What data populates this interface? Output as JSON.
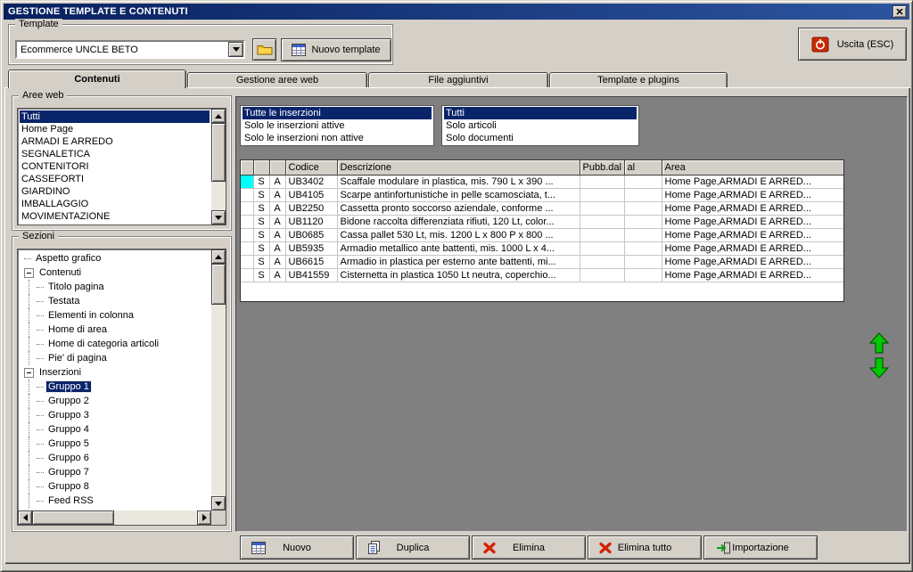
{
  "window": {
    "title": "GESTIONE TEMPLATE E CONTENUTI"
  },
  "toolbar": {
    "template_group_label": "Template",
    "template_combo_value": "Ecommerce UNCLE BETO",
    "new_template_label": "Nuovo template",
    "exit_label": "Uscita (ESC)"
  },
  "tabs": [
    {
      "label": "Contenuti",
      "active": true
    },
    {
      "label": "Gestione aree web",
      "active": false
    },
    {
      "label": "File aggiuntivi",
      "active": false
    },
    {
      "label": "Template e plugins",
      "active": false
    }
  ],
  "aree_web": {
    "group_label": "Aree web",
    "items": [
      {
        "label": "Tutti",
        "selected": true
      },
      {
        "label": "Home Page"
      },
      {
        "label": "ARMADI E ARREDO"
      },
      {
        "label": "SEGNALETICA"
      },
      {
        "label": "CONTENITORI"
      },
      {
        "label": "CASSEFORTI"
      },
      {
        "label": "GIARDINO"
      },
      {
        "label": "IMBALLAGGIO"
      },
      {
        "label": "MOVIMENTAZIONE"
      }
    ]
  },
  "sezioni": {
    "group_label": "Sezioni",
    "items": [
      {
        "label": "Aspetto grafico",
        "level": 0,
        "exp": "none"
      },
      {
        "label": "Contenuti",
        "level": 0,
        "exp": "minus"
      },
      {
        "label": "Titolo pagina",
        "level": 1,
        "exp": "none"
      },
      {
        "label": "Testata",
        "level": 1,
        "exp": "none"
      },
      {
        "label": "Elementi in colonna",
        "level": 1,
        "exp": "none"
      },
      {
        "label": "Home di area",
        "level": 1,
        "exp": "none"
      },
      {
        "label": "Home di categoria articoli",
        "level": 1,
        "exp": "none"
      },
      {
        "label": "Pie' di pagina",
        "level": 1,
        "exp": "none"
      },
      {
        "label": "Inserzioni",
        "level": 0,
        "exp": "minus"
      },
      {
        "label": "Gruppo 1",
        "level": 1,
        "exp": "none",
        "selected": true
      },
      {
        "label": "Gruppo 2",
        "level": 1,
        "exp": "none"
      },
      {
        "label": "Gruppo 3",
        "level": 1,
        "exp": "none"
      },
      {
        "label": "Gruppo 4",
        "level": 1,
        "exp": "none"
      },
      {
        "label": "Gruppo 5",
        "level": 1,
        "exp": "none"
      },
      {
        "label": "Gruppo 6",
        "level": 1,
        "exp": "none"
      },
      {
        "label": "Gruppo 7",
        "level": 1,
        "exp": "none"
      },
      {
        "label": "Gruppo 8",
        "level": 1,
        "exp": "none"
      },
      {
        "label": "Feed RSS",
        "level": 1,
        "exp": "none"
      }
    ]
  },
  "filters": {
    "inserzioni": [
      {
        "label": "Tutte le inserzioni",
        "selected": true
      },
      {
        "label": "Solo le inserzioni attive"
      },
      {
        "label": "Solo le inserzioni non attive"
      }
    ],
    "tipo": [
      {
        "label": "Tutti",
        "selected": true
      },
      {
        "label": "Solo articoli"
      },
      {
        "label": "Solo documenti"
      }
    ]
  },
  "table": {
    "columns": [
      "",
      "",
      "",
      "Codice",
      "Descrizione",
      "Pubb.dal",
      "al",
      "Area"
    ],
    "rows": [
      {
        "current": true,
        "s": "S",
        "a": "A",
        "codice": "UB3402",
        "descrizione": "Scaffale modulare in plastica, mis. 790 L x 390 ...",
        "pubb_dal": "",
        "al": "",
        "area": "Home Page,ARMADI E ARRED..."
      },
      {
        "s": "S",
        "a": "A",
        "codice": "UB4105",
        "descrizione": "Scarpe antinfortunistiche in pelle scamosciata, t...",
        "pubb_dal": "",
        "al": "",
        "area": "Home Page,ARMADI E ARRED..."
      },
      {
        "s": "S",
        "a": "A",
        "codice": "UB2250",
        "descrizione": "Cassetta pronto soccorso aziendale, conforme ...",
        "pubb_dal": "",
        "al": "",
        "area": "Home Page,ARMADI E ARRED..."
      },
      {
        "s": "S",
        "a": "A",
        "codice": "UB1120",
        "descrizione": "Bidone raccolta differenziata rifiuti, 120 Lt, color...",
        "pubb_dal": "",
        "al": "",
        "area": "Home Page,ARMADI E ARRED..."
      },
      {
        "s": "S",
        "a": "A",
        "codice": "UB0685",
        "descrizione": "Cassa pallet 530 Lt, mis. 1200 L x 800 P x 800 ...",
        "pubb_dal": "",
        "al": "",
        "area": "Home Page,ARMADI E ARRED..."
      },
      {
        "s": "S",
        "a": "A",
        "codice": "UB5935",
        "descrizione": "Armadio metallico ante battenti, mis. 1000 L x 4...",
        "pubb_dal": "",
        "al": "",
        "area": "Home Page,ARMADI E ARRED..."
      },
      {
        "s": "S",
        "a": "A",
        "codice": "UB6615",
        "descrizione": "Armadio in plastica per esterno ante battenti, mi...",
        "pubb_dal": "",
        "al": "",
        "area": "Home Page,ARMADI E ARRED..."
      },
      {
        "s": "S",
        "a": "A",
        "codice": "UB41559",
        "descrizione": "Cisternetta in plastica 1050 Lt neutra, coperchio...",
        "pubb_dal": "",
        "al": "",
        "area": "Home Page,ARMADI E ARRED..."
      }
    ]
  },
  "footer_buttons": [
    {
      "label": "Nuovo",
      "icon": "new-icon"
    },
    {
      "label": "Duplica",
      "icon": "copy-icon"
    },
    {
      "label": "Elimina",
      "icon": "delete-icon"
    },
    {
      "label": "Elimina tutto",
      "icon": "delete-all-icon"
    },
    {
      "label": "Importazione",
      "icon": "import-icon"
    }
  ],
  "move_buttons": {
    "up": "move-up",
    "down": "move-down"
  },
  "colors": {
    "titlebar": "#0a246a",
    "selection": "#0a246a",
    "face": "#d4d0c8",
    "content_panel": "#808080",
    "current_row_marker": "#00ffff",
    "move_arrow_green": "#00c800",
    "delete_red": "#d42000"
  }
}
